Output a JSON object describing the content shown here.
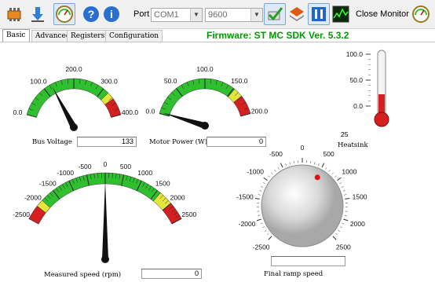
{
  "toolbar": {
    "port_label": "Port",
    "port_value": "COM1",
    "baud_value": "9600",
    "close_monitor_label": "Close Monitor"
  },
  "tabs": [
    "Basic",
    "Advanced",
    "Registers",
    "Configuration"
  ],
  "firmware_text": "Firmware: ST MC SDK Ver. 5.3.2",
  "gauges": {
    "bus_voltage": {
      "label": "Bus Voltage",
      "value": "133",
      "ticks": [
        "0.0",
        "100.0",
        "200.0",
        "300.0",
        "400.0"
      ]
    },
    "motor_power": {
      "label": "Motor Power (W)",
      "value": "0",
      "ticks": [
        "0.0",
        "50.0",
        "100.0",
        "150.0",
        "200.0"
      ]
    },
    "measured_speed": {
      "label": "Measured speed (rpm)",
      "value": "0",
      "ticks": [
        "-2500",
        "-2000",
        "-1500",
        "-1000",
        "-500",
        "0",
        "500",
        "1000",
        "1500",
        "2000",
        "2500"
      ]
    },
    "heatsink": {
      "label": "Heatsink",
      "value": "25",
      "ticks": [
        "100.0",
        "50.0",
        "0.0"
      ]
    },
    "ramp_speed": {
      "label": "Final ramp speed",
      "value": "",
      "ticks": [
        "-2500",
        "-2000",
        "-1500",
        "-1000",
        "-500",
        "0",
        "500",
        "1000",
        "1500",
        "2000",
        "2500"
      ]
    }
  },
  "colors": {
    "green": "#2fbf2f",
    "yellow": "#e6e63a",
    "red": "#d42020",
    "firmware": "#009b00"
  },
  "icons": [
    "chip-icon",
    "download-arrow-icon",
    "gauge-icon",
    "help-icon",
    "info-icon",
    "connect-check-icon",
    "layers-icon",
    "pause-icon",
    "scope-icon",
    "close-monitor-gauge-icon"
  ]
}
